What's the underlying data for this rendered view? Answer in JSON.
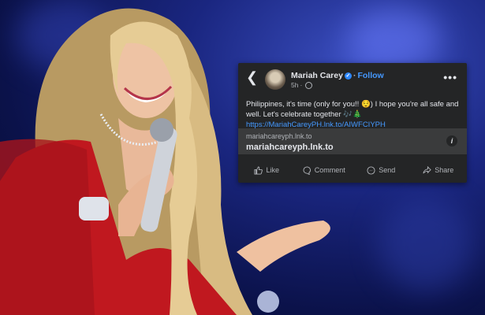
{
  "post": {
    "author": "Mariah Carey",
    "follow": "Follow",
    "time": "5h",
    "text": "Philippines, it's time (only for you!! 😌) I hope you're all safe and well. Let's celebrate together 🎶🎄",
    "link_text": "https://MariahCareyPH.lnk.to/AIWFCIYPH",
    "link_domain": "mariahcareyph.lnk.to",
    "link_title": "mariahcareyph.lnk.to"
  },
  "actions": {
    "like": "Like",
    "comment": "Comment",
    "send": "Send",
    "share": "Share"
  }
}
